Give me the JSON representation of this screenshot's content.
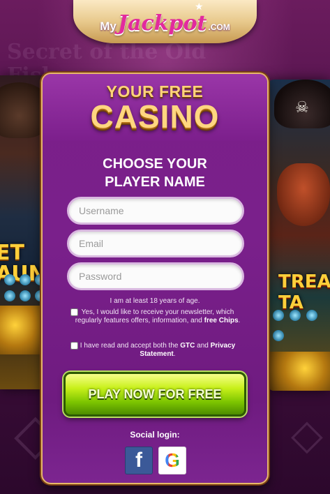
{
  "brand": {
    "my": "My",
    "jackpot": "Jackpot",
    "dotcom": ".COM"
  },
  "background": {
    "text": "Secret of the Old Fisherman",
    "left_slot_title": "ET AUN",
    "right_slot_title": "TREA TA"
  },
  "panel": {
    "headline_line1": "YOUR FREE",
    "headline_line2": "CASINO",
    "subheading_line1": "CHOOSE YOUR",
    "subheading_line2": "PLAYER NAME",
    "form": {
      "username_placeholder": "Username",
      "email_placeholder": "Email",
      "password_placeholder": "Password",
      "age_notice": "I am at least 18 years of age.",
      "newsletter_text": "Yes, I would like to receive your newsletter, which regularly features offers, information, and",
      "newsletter_bold": "free Chips",
      "newsletter_end": ".",
      "terms_text_1": "I have read and accept both the",
      "terms_gtc": "GTC",
      "terms_and": "and",
      "terms_privacy": "Privacy Statement",
      "terms_end": "."
    },
    "cta_label": "PLAY NOW FOR FREE",
    "social_login_label": "Social login:",
    "social": {
      "facebook_glyph": "f",
      "google_glyph": "G"
    }
  },
  "colors": {
    "panel_purple": "#7b1f8a",
    "gold": "#ffd680",
    "cta_green": "#7bc400",
    "facebook_blue": "#3b5998"
  }
}
